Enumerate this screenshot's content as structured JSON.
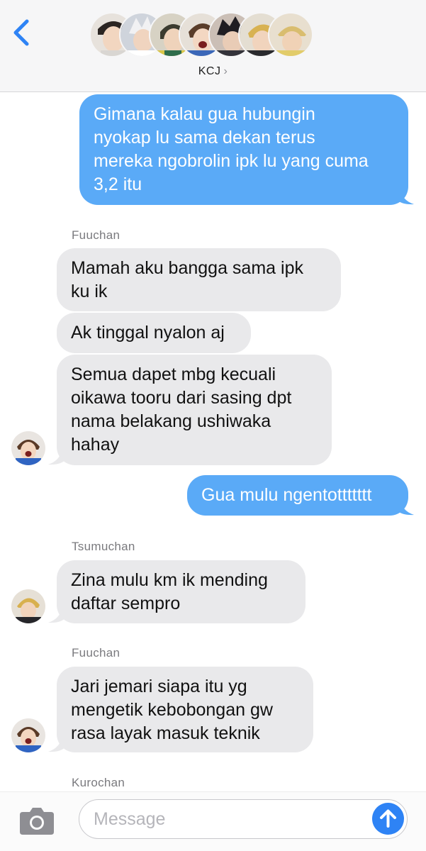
{
  "header": {
    "group_name": "KCJ",
    "group_chevron": "›",
    "back_icon": "chevron-left-icon",
    "member_avatar_count": 7
  },
  "conversation": {
    "messages": [
      {
        "direction": "outgoing",
        "text_lines": [
          "Gimana kalau gua hubungin",
          "nyokap lu sama dekan terus",
          "mereka ngobrolin ipk lu yang cuma",
          "3,2 itu"
        ]
      },
      {
        "direction": "incoming",
        "sender": "Fuuchan",
        "text_lines": [
          "Mamah aku bangga sama ipk",
          "ku ik"
        ]
      },
      {
        "direction": "incoming",
        "text_lines": [
          "Ak tinggal nyalon aj"
        ]
      },
      {
        "direction": "incoming",
        "text_lines": [
          "Semua dapet mbg kecuali",
          "oikawa tooru dari sasing dpt",
          "nama belakang ushiwaka",
          "hahay"
        ]
      },
      {
        "direction": "outgoing",
        "text_lines": [
          "Gua mulu ngentottttttt"
        ]
      },
      {
        "direction": "incoming",
        "sender": "Tsumuchan",
        "text_lines": [
          "Zina mulu km ik mending",
          "daftar sempro"
        ]
      },
      {
        "direction": "incoming",
        "sender": "Fuuchan",
        "text_lines": [
          "Jari jemari siapa itu yg",
          "mengetik kebobongan gw",
          "rasa layak masuk teknik"
        ]
      },
      {
        "direction": "incoming",
        "sender": "Kurochan",
        "text_lines": []
      }
    ]
  },
  "composer": {
    "placeholder": "Message",
    "camera_icon": "camera-icon",
    "send_icon": "arrow-up-icon"
  },
  "colors": {
    "outgoing_bubble": "#5aaaf7",
    "incoming_bubble": "#e9e9eb",
    "accent": "#2e83f5",
    "header_bg": "#f6f6f7"
  }
}
